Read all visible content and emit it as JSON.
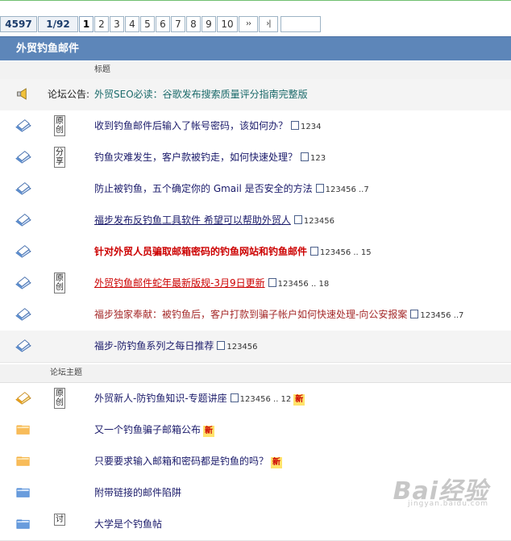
{
  "pager": {
    "total": "4597",
    "page": "1/92",
    "numbers": [
      "1",
      "2",
      "3",
      "4",
      "5",
      "6",
      "7",
      "8",
      "9",
      "10"
    ],
    "next": "››",
    "last": "›|",
    "jump_value": ""
  },
  "forum": {
    "title": "外贸钓鱼邮件"
  },
  "columns": {
    "title_label": "标题",
    "section_label": "论坛主题"
  },
  "announcement": {
    "label": "论坛公告:",
    "text": "外贸SEO必读：谷歌发布搜索质量评分指南完整版"
  },
  "sticky": [
    {
      "badge": "原创",
      "title": "收到钓鱼邮件后输入了帐号密码，该如何办？",
      "pages": "1234",
      "style": "normal"
    },
    {
      "badge": "分享",
      "title": "钓鱼灾难发生，客户款被钓走，如何快速处理？",
      "pages": "123",
      "style": "normal"
    },
    {
      "badge": "",
      "title": "防止被钓鱼，五个确定你的 Gmail 是否安全的方法",
      "pages": "123456 ..7",
      "style": "normal"
    },
    {
      "badge": "",
      "title": "福步发布反钓鱼工具软件 希望可以帮助外贸人",
      "pages": "123456",
      "style": "underline"
    },
    {
      "badge": "",
      "title": "针对外贸人员骗取邮箱密码的钓鱼网站和钓鱼邮件",
      "pages": "123456 .. 15",
      "style": "bold-red"
    },
    {
      "badge": "原创",
      "title": "外贸钓鱼邮件蛇年最新版规-3月9日更新",
      "pages": "123456 .. 18",
      "style": "red-underline"
    },
    {
      "badge": "",
      "title": "福步独家奉献：被钓鱼后，客户打款到骗子帐户如何快速处理-向公安报案",
      "pages": "123456 ..7",
      "style": "dark-red"
    },
    {
      "badge": "",
      "title": "福步-防钓鱼系列之每日推荐",
      "pages": "123456",
      "style": "normal"
    }
  ],
  "threads": [
    {
      "badge": "原创",
      "title": "外贸新人-防钓鱼知识-专题讲座",
      "pages": "123456 .. 12",
      "new": "新",
      "icon": "hot"
    },
    {
      "badge": "",
      "title": "又一个钓鱼骗子邮箱公布",
      "pages": "",
      "new": "新",
      "icon": "folder"
    },
    {
      "badge": "",
      "title": "只要要求输入邮箱和密码都是钓鱼的吗？",
      "pages": "",
      "new": "新",
      "icon": "folder"
    },
    {
      "badge": "",
      "title": "附带链接的邮件陷阱",
      "pages": "",
      "new": "",
      "icon": "folder-blue"
    },
    {
      "badge": "讨",
      "title": "大学是个钓鱼帖",
      "pages": "",
      "new": "",
      "icon": "folder-blue"
    }
  ],
  "watermark": {
    "brand": "Bai经验",
    "url": "jingyan.baidu.com"
  }
}
